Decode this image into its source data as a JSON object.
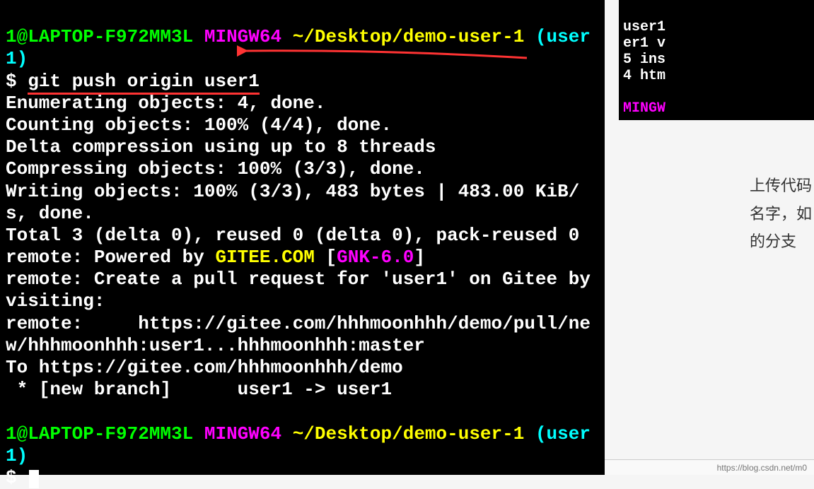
{
  "prompt1": {
    "user_host": "1@LAPTOP-F972MM3L",
    "shell": "MINGW64",
    "path": "~/Desktop/demo-user-1",
    "branch": "(user1)",
    "symbol": "$",
    "command": "git push origin user1"
  },
  "output": {
    "l1": "Enumerating objects: 4, done.",
    "l2": "Counting objects: 100% (4/4), done.",
    "l3": "Delta compression using up to 8 threads",
    "l4": "Compressing objects: 100% (3/3), done.",
    "l5": "Writing objects: 100% (3/3), 483 bytes | 483.00 KiB/s, done.",
    "l6": "Total 3 (delta 0), reused 0 (delta 0), pack-reused 0",
    "l7a": "remote: Powered by ",
    "l7b": "GITEE.COM",
    "l7c": " [",
    "l7d": "GNK-6.0",
    "l7e": "]",
    "l8": "remote: Create a pull request for 'user1' on Gitee by visiting:",
    "l9": "remote:     https://gitee.com/hhhmoonhhh/demo/pull/new/hhhmoonhhh:user1...hhhmoonhhh:master",
    "l10": "To https://gitee.com/hhhmoonhhh/demo",
    "l11": " * [new branch]      user1 -> user1"
  },
  "prompt2": {
    "user_host": "1@LAPTOP-F972MM3L",
    "shell": "MINGW64",
    "path": "~/Desktop/demo-user-1",
    "branch": "(user1)",
    "symbol": "$"
  },
  "secondary": {
    "l1": "user1",
    "l2": "er1 v",
    "l3": "5 ins",
    "l4": "4 htm",
    "shell": "MINGW"
  },
  "side": {
    "t1": "上传代码",
    "t2": "名字，如",
    "t3": "的分支"
  },
  "status": {
    "url": "https://blog.csdn.net/m0"
  }
}
